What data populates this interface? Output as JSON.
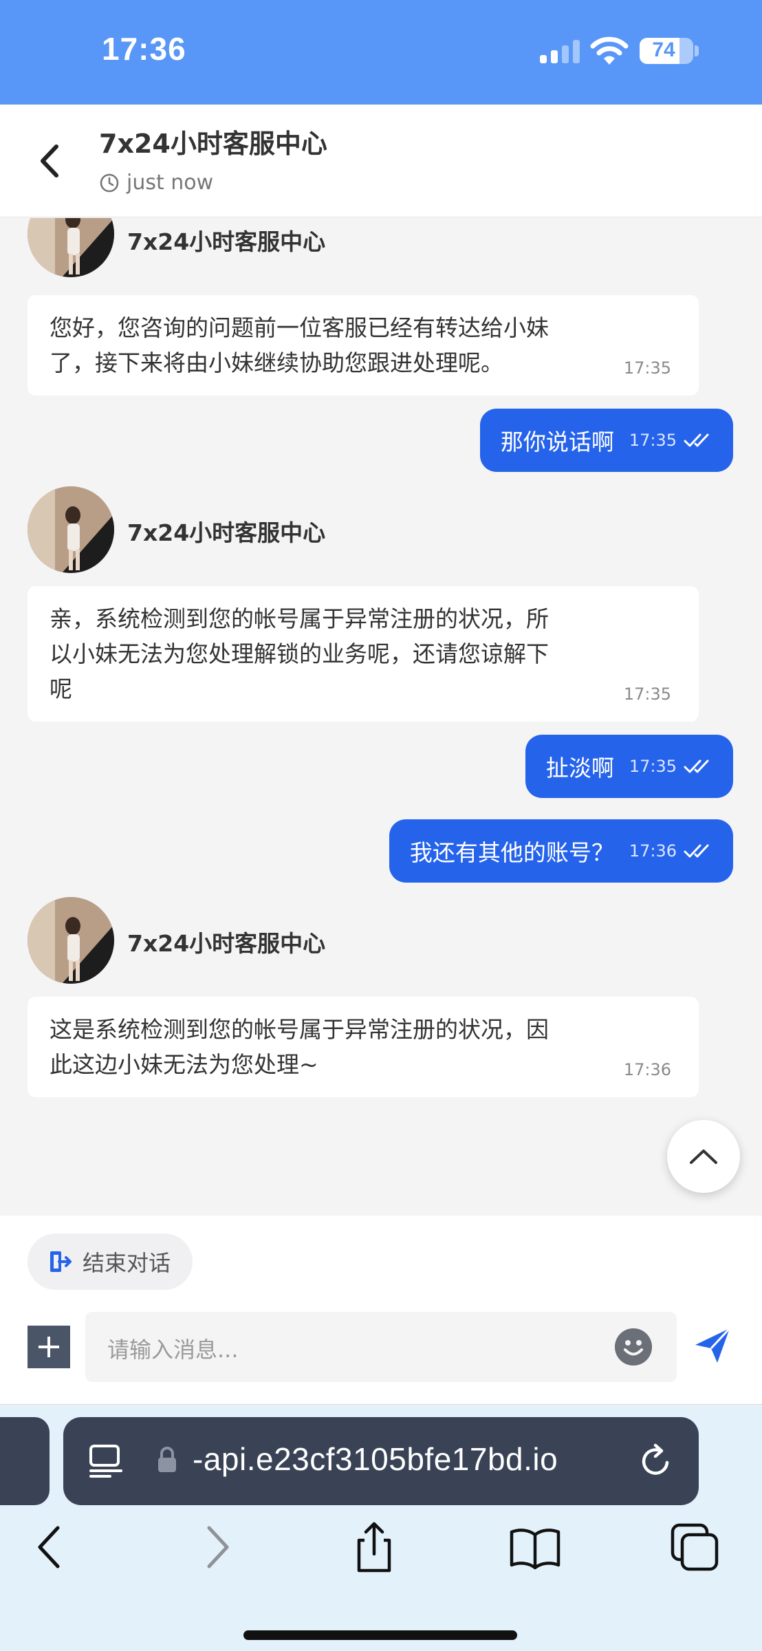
{
  "status_bar": {
    "time": "17:36",
    "battery": "74",
    "battery_level": 0.74
  },
  "header": {
    "title": "7x24小时客服中心",
    "subtitle": "just now"
  },
  "messages": [
    {
      "role": "agent",
      "sender": "7x24小时客服中心",
      "lines": [
        "您好，您咨询的问题前一位客服已经有转达给小妹",
        "了，接下来将由小妹继续协助您跟进处理呢。"
      ],
      "time": "17:35"
    },
    {
      "role": "user",
      "text": "那你说话啊",
      "time": "17:35",
      "status_icon": "double-check-icon"
    },
    {
      "role": "agent",
      "sender": "7x24小时客服中心",
      "lines": [
        "亲，系统检测到您的帐号属于异常注册的状况，所",
        "以小妹无法为您处理解锁的业务呢，还请您谅解下",
        "呢"
      ],
      "time": "17:35"
    },
    {
      "role": "user",
      "text": "扯淡啊",
      "time": "17:35",
      "status_icon": "double-check-icon"
    },
    {
      "role": "user",
      "text": "我还有其他的账号？",
      "time": "17:36",
      "status_icon": "double-check-icon"
    },
    {
      "role": "agent",
      "sender": "7x24小时客服中心",
      "lines": [
        "这是系统检测到您的帐号属于异常注册的状况，因",
        "此这边小妹无法为您处理~"
      ],
      "time": "17:36"
    }
  ],
  "composer": {
    "end_label": "结束对话",
    "placeholder": "请输入消息..."
  },
  "browser": {
    "url": "-api.e23cf3105bfe17bd.io"
  },
  "colors": {
    "status_bar": "#5897f7",
    "accent": "#2563eb",
    "chat_bg": "#f4f4f5",
    "browser_bg": "#e3f1fb",
    "url_bar": "#3a4356"
  },
  "icons": [
    "back-chevron-icon",
    "clock-icon",
    "double-check-icon",
    "chevron-up-icon",
    "exit-icon",
    "plus-icon",
    "emoji-icon",
    "send-icon",
    "reader-icon",
    "lock-icon",
    "reload-icon",
    "share-icon",
    "bookmarks-icon",
    "tabs-icon"
  ]
}
